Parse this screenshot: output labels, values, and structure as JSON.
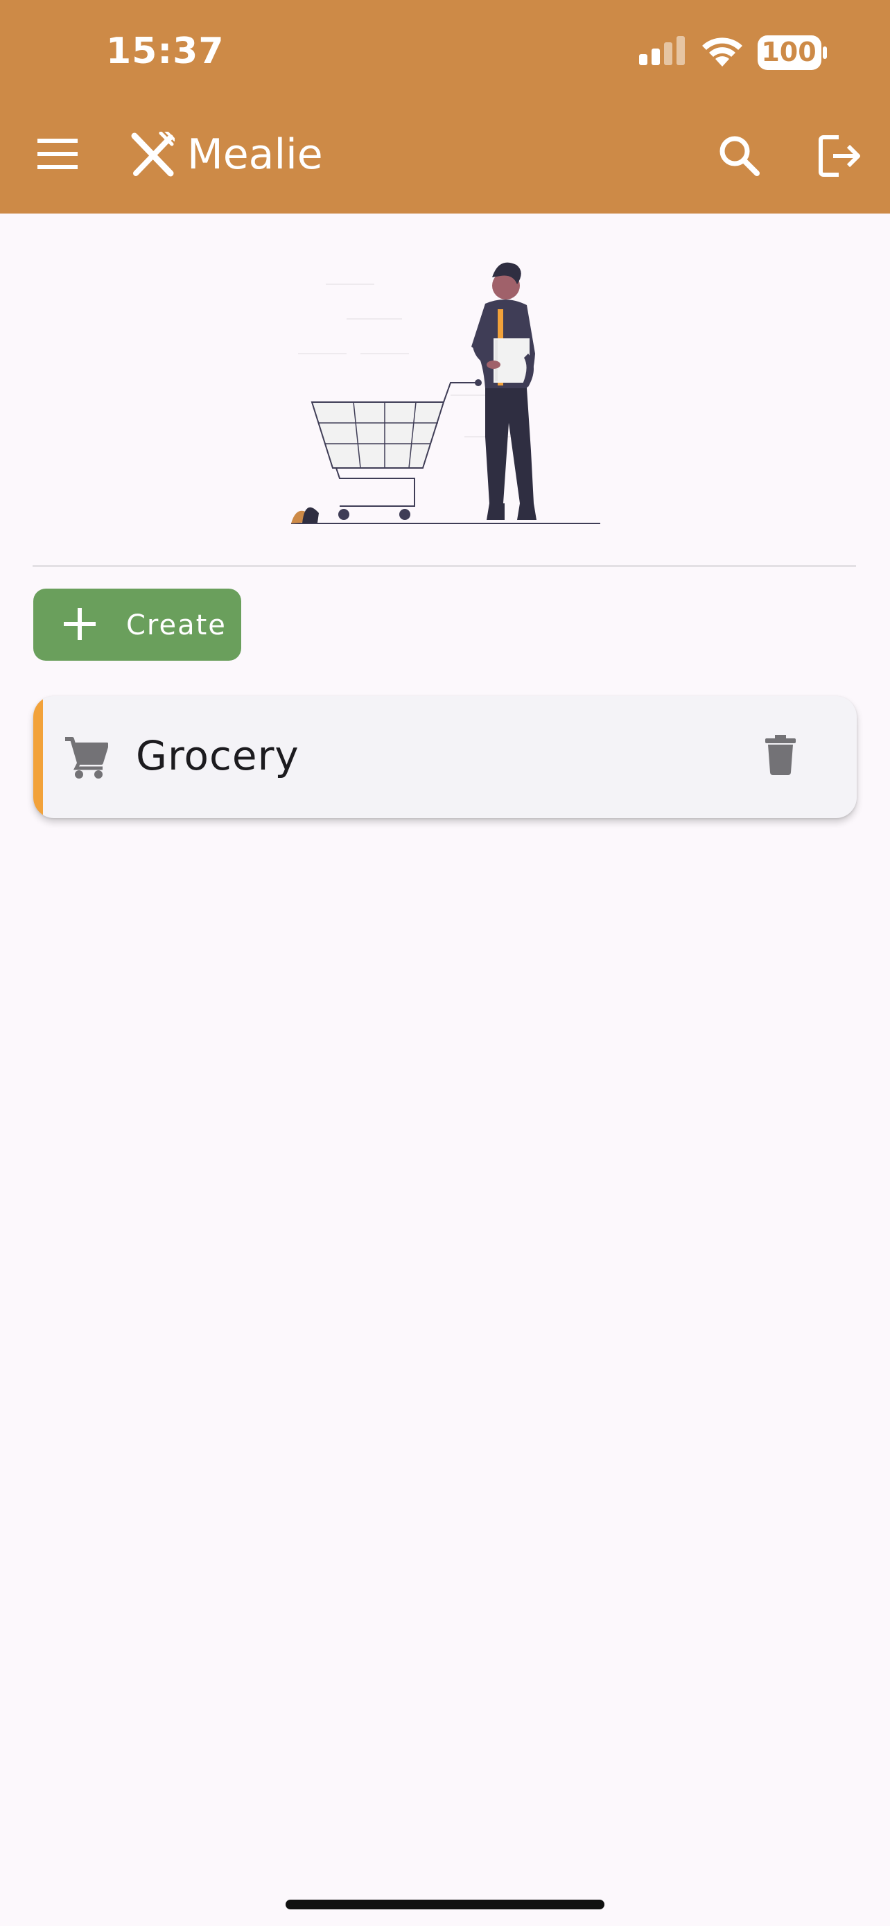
{
  "status_bar": {
    "time": "15:37",
    "battery": "100",
    "icons": [
      "cellular-signal-icon",
      "wifi-icon",
      "battery-icon"
    ]
  },
  "app_bar": {
    "title": "Mealie",
    "icons": [
      "menu-icon",
      "fork-knife-icon",
      "search-icon",
      "logout-icon"
    ]
  },
  "main": {
    "illustration": "shopping-illustration",
    "create_button": {
      "label": "Create",
      "icon": "plus-icon"
    },
    "shopping_lists": [
      {
        "name": "Grocery",
        "icon": "cart-icon",
        "action_icon": "delete-icon"
      }
    ]
  },
  "colors": {
    "app_bar": "#cd8a47",
    "background": "#fcf8fc",
    "create_button": "#6a9f5c",
    "card_accent": "#f2a23a",
    "card_background": "#f4f3f7"
  }
}
